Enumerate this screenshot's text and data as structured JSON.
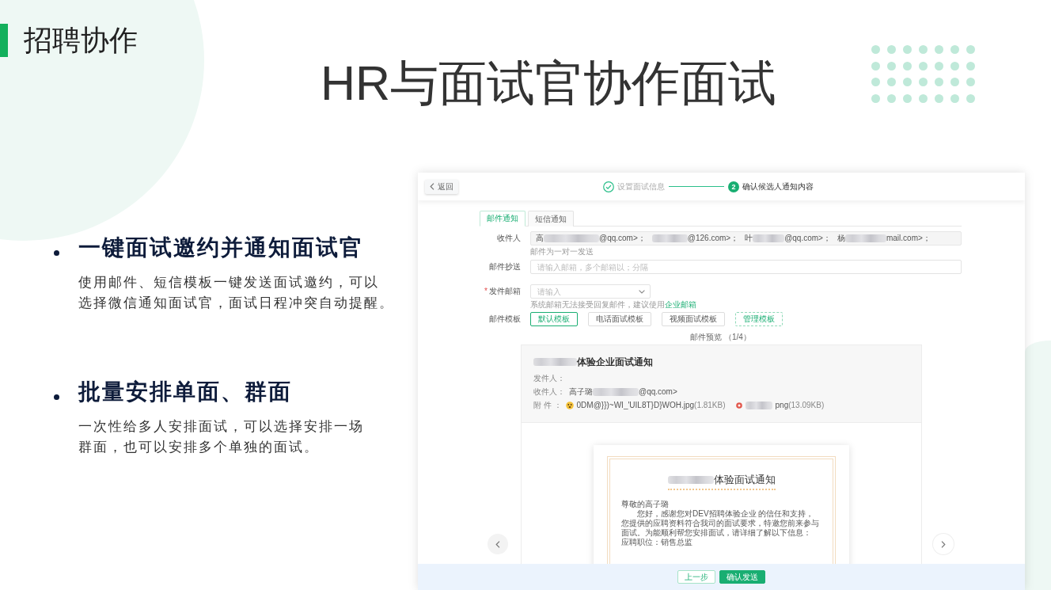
{
  "slide": {
    "section_title": "招聘协作",
    "title": "HR与面试官协作面试"
  },
  "features": [
    {
      "heading": "一键面试邀约并通知面试官",
      "lines": [
        "使用邮件、短信模板一键发送面试邀约，可以",
        "选择微信通知面试官，面试日程冲突自动提醒。"
      ]
    },
    {
      "heading": "批量安排单面、群面",
      "lines": [
        "一次性给多人安排面试，可以选择安排一场",
        "群面，也可以安排多个单独的面试。"
      ]
    }
  ],
  "app": {
    "back_button": "返回",
    "steps": [
      {
        "label": "设置面试信息",
        "done": true,
        "active": false
      },
      {
        "number": "2",
        "label": "确认候选人通知内容",
        "done": false,
        "active": true
      }
    ],
    "tabs": [
      {
        "label": "邮件通知",
        "selected": true
      },
      {
        "label": "短信通知",
        "selected": false
      }
    ],
    "form": {
      "recipients": {
        "label": "收件人",
        "entries": [
          {
            "name": "高",
            "address": "@qq.com>；"
          },
          {
            "address": "@126.com>；"
          },
          {
            "name": "叶",
            "address": "@qq.com>；"
          },
          {
            "name": "杨",
            "address": "mail.com>；"
          }
        ],
        "hint": "邮件为一对一发送"
      },
      "cc": {
        "label": "邮件抄送",
        "placeholder": "请输入邮箱，多个邮箱以；分隔"
      },
      "sender": {
        "required_mark": "*",
        "label": "发件邮箱",
        "placeholder": "请输入",
        "hint": "系统邮箱无法接受回复邮件，建议使用",
        "hint_link": "企业邮箱"
      },
      "template": {
        "label": "邮件模板",
        "options": [
          {
            "label": "默认模板",
            "kind": "template",
            "selected": true
          },
          {
            "label": "电话面试模板",
            "kind": "template",
            "selected": false
          },
          {
            "label": "视频面试模板",
            "kind": "template",
            "selected": false
          },
          {
            "label": "管理模板",
            "kind": "manage",
            "selected": false
          }
        ]
      }
    },
    "preview": {
      "caption": "邮件预览 （1/4）",
      "subject": "体验企业面试通知",
      "from_label": "发件人：",
      "to": {
        "label": "收件人：",
        "name": "高子璐",
        "address": "@qq.com>"
      },
      "attachments": {
        "label": "附 件 ：",
        "files": [
          {
            "kind": "emoji",
            "name": "0DM@}})~WI_'UIL8T}D}WOH.jpg",
            "size": "(1.81KB)"
          },
          {
            "kind": "image",
            "name": "png",
            "size": "(13.09KB)"
          }
        ]
      },
      "letter": {
        "title": "体验面试通知",
        "greeting": "尊敬的高子璐",
        "paragraph": "您好，感谢您对DEV招聘体验企业 的信任和支持，您提供的应聘资料符合我司的面试要求，特邀您前来参与面试。为能顺利帮您安排面试，请详细了解以下信息：",
        "position": "应聘职位：销售总监"
      }
    },
    "actions": [
      {
        "label": "上一步",
        "kind": "secondary"
      },
      {
        "label": "确认发送",
        "kind": "primary"
      }
    ]
  }
}
